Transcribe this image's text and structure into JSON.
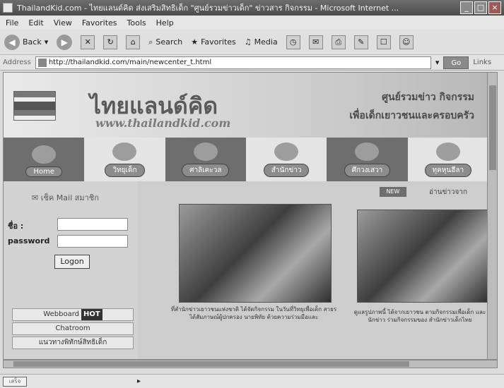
{
  "window": {
    "title": "ThailandKid.com - ไทยแลนด์คิด ส่งเสริมสิทธิเด็ก \"ศูนย์รวมข่าวเด็ก\" ข่าวสาร กิจกรรม - Microsoft Internet ...",
    "min_glyph": "_",
    "max_glyph": "□",
    "close_glyph": "×"
  },
  "menu": [
    "File",
    "Edit",
    "View",
    "Favorites",
    "Tools",
    "Help"
  ],
  "toolbar": {
    "back_label": "Back",
    "search_label": "Search",
    "favorites_label": "Favorites",
    "media_label": "Media"
  },
  "address": {
    "label": "Address",
    "url": "http://thailandkid.com/main/newcenter_t.html",
    "go_label": "Go",
    "links_label": "Links"
  },
  "site": {
    "logo_thai": "ไทยแลนด์คิด",
    "logo_url": "www.thailandkid.com",
    "tagline_line1": "ศูนย์รวมข่าว กิจกรรม",
    "tagline_line2": "เพื่อเด็กเยาวชนและครอบครัว"
  },
  "nav": [
    {
      "label": "Home"
    },
    {
      "label": "วิทยุเด็ก"
    },
    {
      "label": "ศาลิเคะวล"
    },
    {
      "label": "สำนักข่าว"
    },
    {
      "label": "ศึกวงเสวา"
    },
    {
      "label": "ทุคหุนฮีลา"
    }
  ],
  "login": {
    "title": "เช็ค Mail สมาชิก",
    "name_label": "ชื่อ :",
    "password_label": "password",
    "logon_label": "Logon"
  },
  "side_links": {
    "webboard": "Webboard",
    "hot": "HOT",
    "chatroom": "Chatroom",
    "third": "แนวทางพิทักษ์สิทธิเด็ก"
  },
  "news": {
    "tag": "NEW",
    "from_label": "อ่านข่าวจาก",
    "caption1": "ที่สำนักข่าวเยาวชนแห่งชาติ ได้จัดกิจกรรม ในวันที่วิทยุเพื่อเด็ก สาธร ได้สัมภาษณ์ผู้ปกครอง นายพิทัย ด้วยความร่วมมือและ",
    "caption2": "ดูแลรูปภาพนี้ ได้จากเยาวชน ตามกิจกรรมเพื่อเด็ก และ นักข่าว ร่วมกิจกรรมของ สำนักข่าวเด็กไทย"
  },
  "status": {
    "box": "เสร็จ"
  }
}
